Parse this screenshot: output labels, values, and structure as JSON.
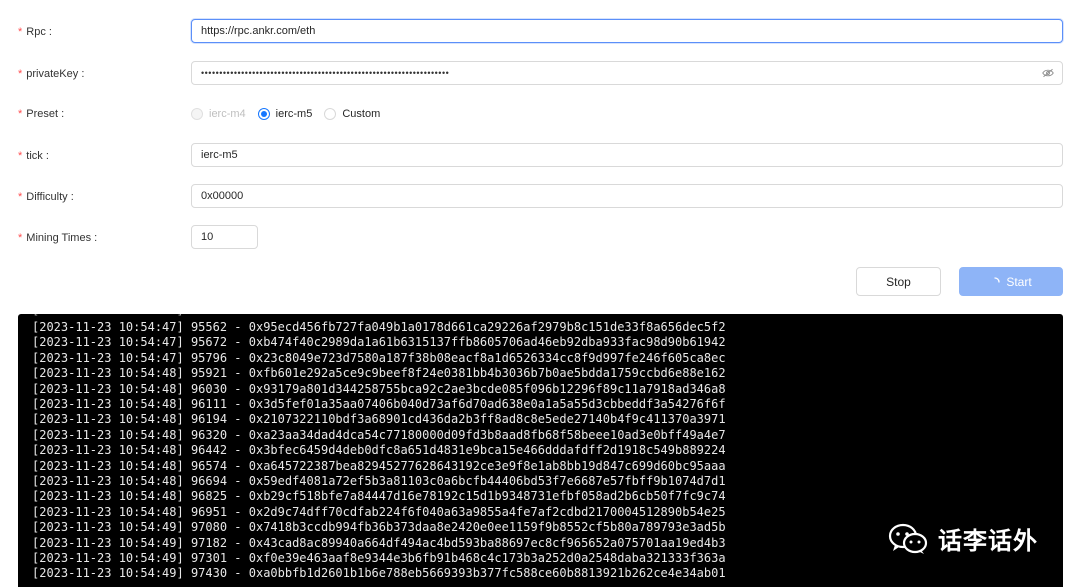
{
  "form": {
    "rpc": {
      "label": "Rpc",
      "value": "https://rpc.ankr.com/eth"
    },
    "private_key": {
      "label": "privateKey",
      "masked": "••••••••••••••••••••••••••••••••••••••••••••••••••••••••••••••••••••"
    },
    "preset": {
      "label": "Preset",
      "options": [
        {
          "label": "ierc-m4",
          "state": "disabled"
        },
        {
          "label": "ierc-m5",
          "state": "checked"
        },
        {
          "label": "Custom",
          "state": "unchecked"
        }
      ]
    },
    "tick": {
      "label": "tick",
      "value": "ierc-m5"
    },
    "difficulty": {
      "label": "Difficulty",
      "value": "0x00000"
    },
    "mining_times": {
      "label": "Mining Times",
      "value": "10"
    },
    "label_suffix": ":"
  },
  "buttons": {
    "stop": "Stop",
    "start": "Start"
  },
  "console": {
    "lines": [
      "[2023-11-23 10:54:47] 95562 - 0x95ecd456fb727fa049b1a0178d661ca29226af2979b8c151de33f8a656dec5f2",
      "[2023-11-23 10:54:47] 95672 - 0xb474f40c2989da1a61b6315137ffb8605706ad46eb92dba933fac98d90b61942",
      "[2023-11-23 10:54:47] 95796 - 0x23c8049e723d7580a187f38b08eacf8a1d6526334cc8f9d997fe246f605ca8ec",
      "[2023-11-23 10:54:48] 95921 - 0xfb601e292a5ce9c9beef8f24e0381bb4b3036b7b0ae5bdda1759ccbd6e88e162",
      "[2023-11-23 10:54:48] 96030 - 0x93179a801d344258755bca92c2ae3bcde085f096b12296f89c11a7918ad346a8",
      "[2023-11-23 10:54:48] 96111 - 0x3d5fef01a35aa07406b040d73af6d70ad638e0a1a5a55d3cbbeddf3a54276f6f",
      "[2023-11-23 10:54:48] 96194 - 0x2107322110bdf3a68901cd436da2b3ff8ad8c8e5ede27140b4f9c411370a3971",
      "[2023-11-23 10:54:48] 96320 - 0xa23aa34dad4dca54c77180000d09fd3b8aad8fb68f58beee10ad3e0bff49a4e7",
      "[2023-11-23 10:54:48] 96442 - 0x3bfec6459d4deb0dfc8a651d4831e9bca15e466dddafdff2d1918c549b889224",
      "[2023-11-23 10:54:48] 96574 - 0xa645722387bea82945277628643192ce3e9f8e1ab8bb19d847c699d60bc95aaa",
      "[2023-11-23 10:54:48] 96694 - 0x59edf4081a72ef5b3a81103c0a6bcfb44406bd53f7e6687e57fbff9b1074d7d1",
      "[2023-11-23 10:54:48] 96825 - 0xb29cf518bfe7a84447d16e78192c15d1b9348731efbf058ad2b6cb50f7fc9c74",
      "[2023-11-23 10:54:48] 96951 - 0x2d9c74dff70cdfab224f6f040a63a9855a4fe7af2cdbd2170004512890b54e25",
      "[2023-11-23 10:54:49] 97080 - 0x7418b3ccdb994fb36b373daa8e2420e0ee1159f9b8552cf5b80a789793e3ad5b",
      "[2023-11-23 10:54:49] 97182 - 0x43cad8ac89940a664df494ac4bd593ba88697ec8cf965652a075701aa19ed4b3",
      "[2023-11-23 10:54:49] 97301 - 0xf0e39e463aaf8e9344e3b6fb91b468c4c173b3a252d0a2548daba321333f363a",
      "[2023-11-23 10:54:49] 97430 - 0xa0bbfb1d2601b1b6e788eb5669393b377fc588ce60b8813921b262ce4e34ab01"
    ]
  },
  "watermark": {
    "text": "话李话外",
    "icon": "wechat-icon"
  },
  "colors": {
    "primary": "#1677ff",
    "start_button": "#8eb4f7",
    "required": "#ff4d4f",
    "console_bg": "#000000"
  }
}
